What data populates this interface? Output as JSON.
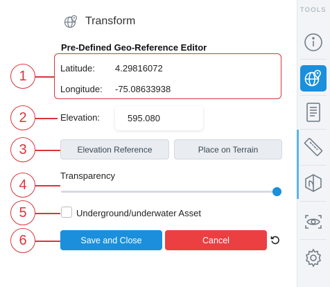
{
  "panel": {
    "title": "Transform",
    "section_title": "Pre-Defined Geo-Reference Editor"
  },
  "coords": {
    "latitude_label": "Latitude:",
    "latitude_value": "4.29816072",
    "longitude_label": "Longitude:",
    "longitude_value": "-75.08633938"
  },
  "elevation": {
    "label": "Elevation:",
    "value": "595.080"
  },
  "buttons": {
    "elevation_reference": "Elevation Reference",
    "place_on_terrain": "Place on Terrain",
    "save_close": "Save and Close",
    "cancel": "Cancel"
  },
  "transparency": {
    "label": "Transparency",
    "level": 1.0
  },
  "underground": {
    "label": "Underground/underwater Asset",
    "checked": false
  },
  "annotations": [
    "1",
    "2",
    "3",
    "4",
    "5",
    "6"
  ],
  "sidebar": {
    "label": "TOOLS",
    "tools": [
      "info-icon",
      "globe-pin-icon",
      "document-icon",
      "ruler-icon",
      "layers-icon",
      "eye-icon",
      "gear-icon"
    ],
    "active_tool": "globe-pin-icon"
  },
  "colors": {
    "accent": "#1b8fdc",
    "danger": "#eb3f42",
    "annotation": "#d9343a"
  }
}
